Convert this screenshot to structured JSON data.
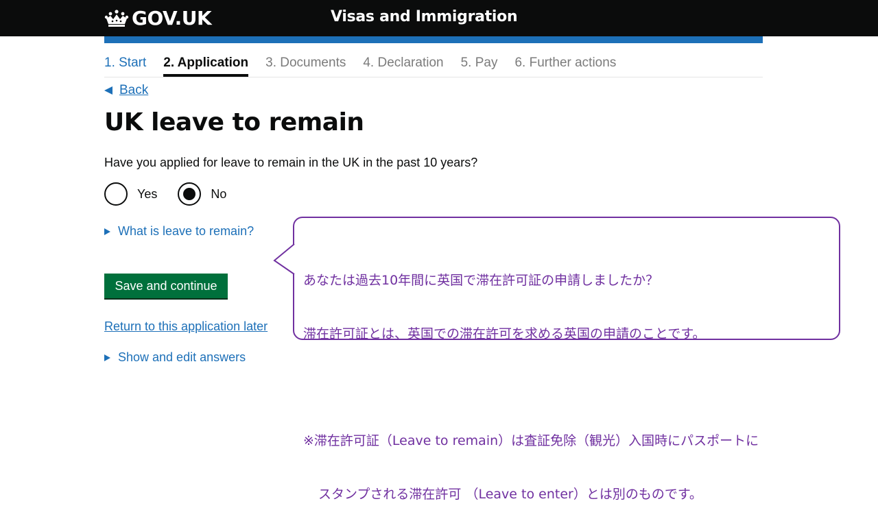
{
  "header": {
    "logo_text": "GOV.UK",
    "service_name": "Visas and Immigration"
  },
  "steps": [
    {
      "label": "1. Start",
      "state": "done"
    },
    {
      "label": "2. Application",
      "state": "current"
    },
    {
      "label": "3. Documents",
      "state": "todo"
    },
    {
      "label": "4. Declaration",
      "state": "todo"
    },
    {
      "label": "5. Pay",
      "state": "todo"
    },
    {
      "label": "6. Further actions",
      "state": "todo"
    }
  ],
  "back_link": "Back",
  "page_title": "UK leave to remain",
  "question": "Have you applied for leave to remain in the UK in the past 10 years?",
  "options": [
    {
      "label": "Yes",
      "selected": false
    },
    {
      "label": "No",
      "selected": true
    }
  ],
  "details_what": "What is leave to remain?",
  "save_button": "Save and continue",
  "return_link": "Return to this application later",
  "details_show": "Show and edit answers",
  "callout": {
    "line1": "あなたは過去10年間に英国で滞在許可証の申請しましたか？",
    "line2": "滞在許可証とは、英国での滞在許可を求める英国の申請のことです。",
    "line3": "※滞在許可証（Leave to remain）は査証免除（観光）入国時にパスポートに",
    "line4": "スタンプされる滞在許可 （Leave to enter）とは別のものです。"
  },
  "colors": {
    "header_bg": "#0b0c0c",
    "brand_blue": "#1d70b8",
    "button_green": "#00703c",
    "callout_purple": "#7030a0"
  }
}
